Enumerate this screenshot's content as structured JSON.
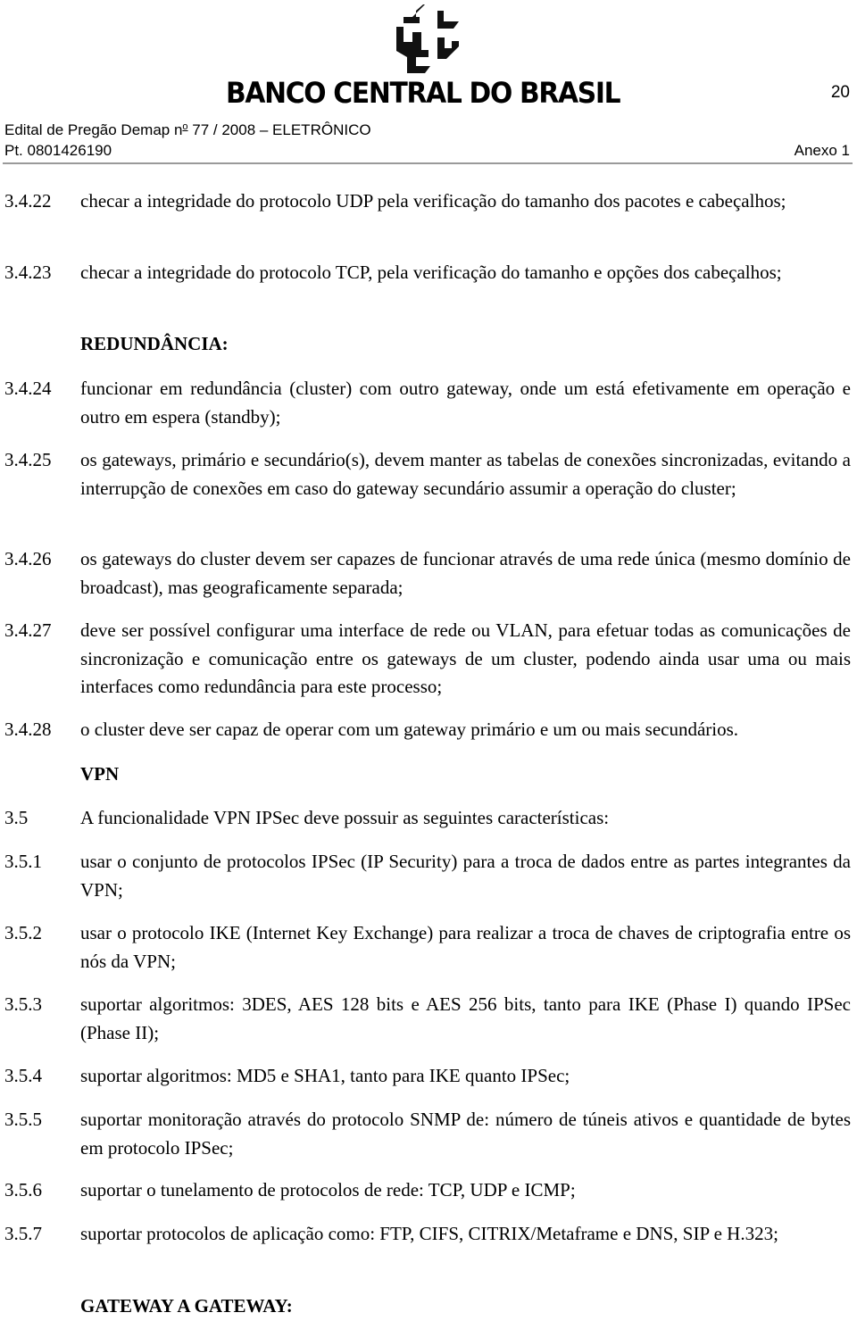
{
  "header": {
    "brand": "BANCO CENTRAL DO BRASIL",
    "page_number": "20",
    "edital_prefix": "Edital de Pregão Demap n",
    "edital_ordinal": "o",
    "edital_suffix": " 77 / 2008 – ELETRÔNICO",
    "protocol": "Pt. 0801426190",
    "annex": "Anexo 1",
    "logo_icon": "banco-central-logo"
  },
  "items": [
    {
      "num": "3.4.22",
      "text": "checar a integridade do protocolo UDP pela verificação do tamanho dos pacotes e cabeçalhos;"
    },
    {
      "num": "3.4.23",
      "text": "checar a integridade do protocolo TCP, pela verificação do tamanho e opções dos cabeçalhos;"
    },
    {
      "num": "3.4.24",
      "text": "funcionar em redundância (cluster) com outro gateway, onde um está efetivamente em operação e outro em espera (standby);"
    },
    {
      "num": "3.4.25",
      "text": "os gateways, primário e secundário(s), devem manter as tabelas de conexões sincronizadas, evitando a interrupção de conexões em caso do gateway secundário assumir a operação do cluster;"
    },
    {
      "num": "3.4.26",
      "text": "os gateways do cluster devem ser capazes de funcionar através de uma rede única (mesmo domínio de broadcast), mas geograficamente separada;"
    },
    {
      "num": "3.4.27",
      "text": "deve ser possível configurar uma interface de rede ou VLAN, para efetuar todas as comunicações de sincronização e comunicação entre os gateways de um cluster, podendo ainda usar uma ou mais interfaces como redundância para este processo;"
    },
    {
      "num": "3.4.28",
      "text": "o cluster deve ser capaz de operar com um gateway primário e um ou mais secundários."
    },
    {
      "num": "3.5",
      "text": "A funcionalidade VPN IPSec deve possuir as seguintes características:"
    },
    {
      "num": "3.5.1",
      "text": "usar o conjunto de protocolos IPSec (IP Security) para a troca de dados entre as partes integrantes da VPN;"
    },
    {
      "num": "3.5.2",
      "text": "usar o protocolo IKE (Internet Key Exchange) para realizar a troca de chaves de criptografia entre os nós da VPN;"
    },
    {
      "num": "3.5.3",
      "text": "suportar algoritmos: 3DES, AES 128 bits e AES 256 bits, tanto para IKE (Phase I) quando IPSec (Phase II);"
    },
    {
      "num": "3.5.4",
      "text": "suportar algoritmos: MD5 e SHA1, tanto para IKE quanto IPSec;"
    },
    {
      "num": "3.5.5",
      "text": "suportar monitoração através do protocolo SNMP de: número de túneis ativos e quantidade de bytes em protocolo IPSec;"
    },
    {
      "num": "3.5.6",
      "text": "suportar o tunelamento de protocolos de rede: TCP, UDP e ICMP;"
    },
    {
      "num": "3.5.7",
      "text": "suportar protocolos de aplicação como: FTP, CIFS, CITRIX/Metaframe e DNS, SIP e H.323;"
    }
  ],
  "headings": {
    "redundancia": "REDUNDÂNCIA:",
    "vpn": "VPN",
    "gateway": "GATEWAY A GATEWAY:"
  }
}
